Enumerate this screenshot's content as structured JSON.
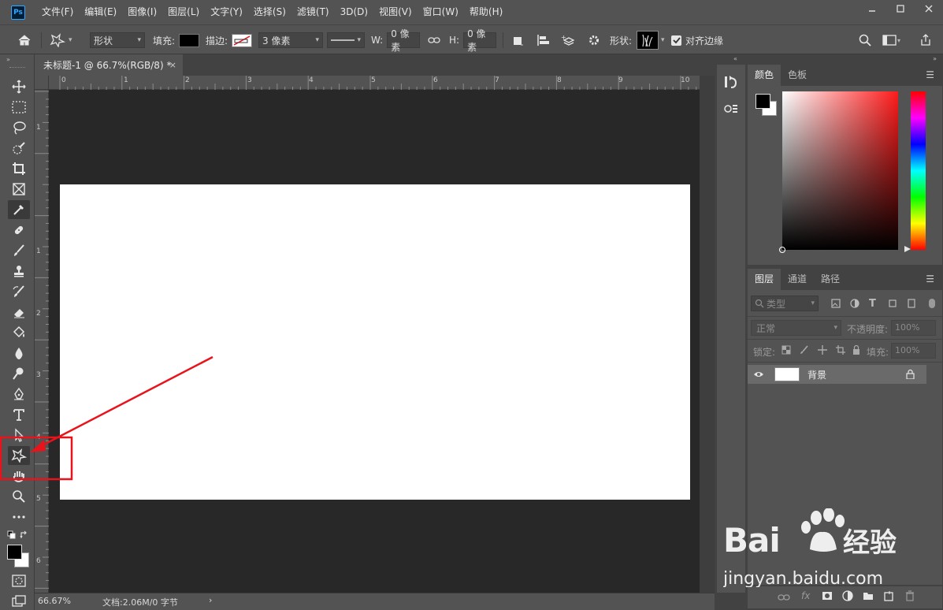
{
  "menubar": {
    "logo": "Ps",
    "items": [
      "文件(F)",
      "编辑(E)",
      "图像(I)",
      "图层(L)",
      "文字(Y)",
      "选择(S)",
      "滤镜(T)",
      "3D(D)",
      "视图(V)",
      "窗口(W)",
      "帮助(H)"
    ],
    "window_controls": [
      "minimize-icon",
      "maximize-icon",
      "close-icon"
    ]
  },
  "options": {
    "mode": "形状",
    "fill_label": "填充:",
    "stroke_label": "描边:",
    "stroke_width": "3 像素",
    "w_label": "W:",
    "w_value": "0 像素",
    "h_label": "H:",
    "h_value": "0 像素",
    "shape_label": "形状:",
    "align_edges": "对齐边缘",
    "align_edges_checked": true
  },
  "document": {
    "tab_title": "未标题-1 @ 66.7%(RGB/8) *",
    "tab_close": "×",
    "ruler_h": [
      "0",
      "1",
      "2",
      "3",
      "4",
      "5",
      "6",
      "7",
      "8",
      "9",
      "10"
    ],
    "ruler_v": [
      "1",
      "1",
      "2",
      "3",
      "4",
      "5",
      "6"
    ],
    "zoom": "66.67%",
    "doc_info": "文档:2.06M/0 字节",
    "status_arrow": "›"
  },
  "color_panel": {
    "tabs": [
      "颜色",
      "色板"
    ],
    "active_tab": "颜色",
    "foreground": "#000000",
    "background": "#ffffff",
    "hue_color": "#ff1b1b"
  },
  "layers_panel": {
    "tabs": [
      "图层",
      "通道",
      "路径"
    ],
    "active_tab": "图层",
    "filter_kind": "类型",
    "blend_mode": "正常",
    "opacity_label": "不透明度:",
    "opacity_value": "100%",
    "lock_label": "锁定:",
    "fill_label": "填充:",
    "fill_value": "100%",
    "layers": [
      {
        "name": "背景",
        "visible": true,
        "locked": true
      }
    ]
  },
  "watermark": {
    "brand": "Baidu 经验",
    "url": "jingyan.baidu.com"
  },
  "colors": {
    "ui_bg": "#535353",
    "panel_dark": "#424242",
    "canvas_bg": "#282828",
    "highlight_red": "#e8131b"
  }
}
